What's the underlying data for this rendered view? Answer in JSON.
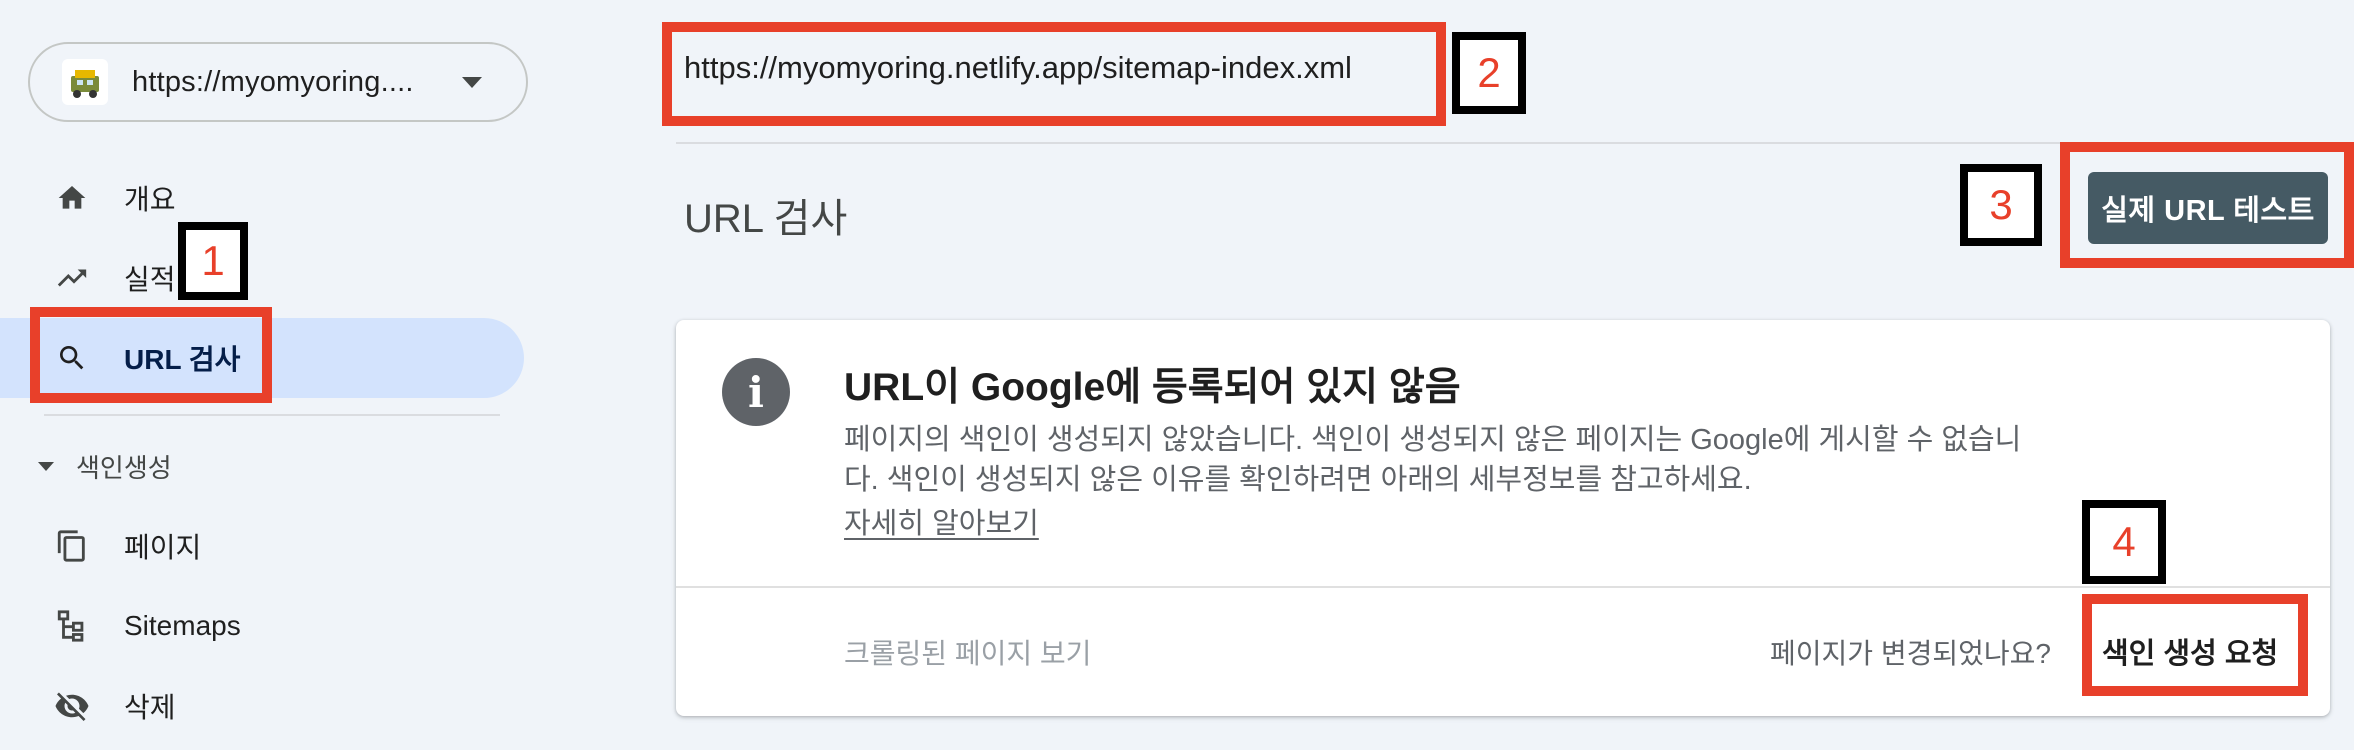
{
  "sidebar": {
    "property_url": "https://myomyoring....",
    "nav": {
      "overview": "개요",
      "performance": "실적",
      "url_inspection": "URL 검사"
    },
    "indexing_section": "색인생성",
    "indexing_items": {
      "pages": "페이지",
      "sitemaps": "Sitemaps",
      "removals": "삭제"
    }
  },
  "main": {
    "inspected_url": "https://myomyoring.netlify.app/sitemap-index.xml",
    "page_title": "URL 검사",
    "live_test_button": "실제 URL 테스트"
  },
  "card": {
    "title": "URL이 Google에 등록되어 있지 않음",
    "description": "페이지의 색인이 생성되지 않았습니다. 색인이 생성되지 않은 페이지는 Google에 게시할 수 없습니다. 색인이 생성되지 않은 이유를 확인하려면 아래의 세부정보를 참고하세요.",
    "learn_more": "자세히 알아보기",
    "view_crawled": "크롤링된 페이지 보기",
    "page_changed": "페이지가 변경되었나요?",
    "request_indexing": "색인 생성 요청"
  },
  "annotations": {
    "n1": "1",
    "n2": "2",
    "n3": "3",
    "n4": "4"
  },
  "colors": {
    "highlight": "#e8402a",
    "active_nav": "#d3e3fd",
    "button": "#455a64",
    "background": "#f0f4f9"
  }
}
